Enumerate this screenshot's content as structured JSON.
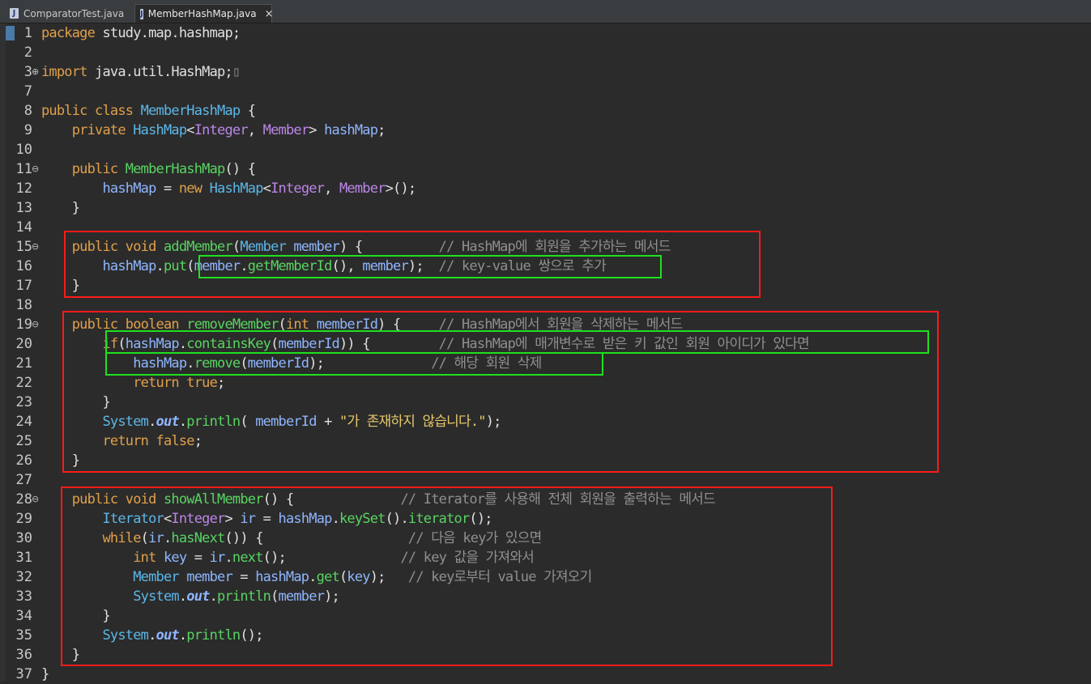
{
  "tabs": [
    {
      "label": "ComparatorTest.java",
      "active": false
    },
    {
      "label": "MemberHashMap.java",
      "active": true,
      "close": "×"
    }
  ],
  "editor": {
    "lines": [
      {
        "n": "1",
        "fold": "",
        "segs": [
          [
            "kw",
            "package"
          ],
          [
            "op",
            " study.map.hashmap;"
          ]
        ]
      },
      {
        "n": "2",
        "fold": "",
        "segs": []
      },
      {
        "n": "3",
        "fold": "+",
        "segs": [
          [
            "kw",
            "import"
          ],
          [
            "op",
            " java.util.HashMap;"
          ],
          [
            "cmt",
            "▯"
          ]
        ]
      },
      {
        "n": "7",
        "fold": "",
        "segs": []
      },
      {
        "n": "8",
        "fold": "",
        "segs": [
          [
            "kw",
            "public class "
          ],
          [
            "cls",
            "MemberHashMap"
          ],
          [
            "op",
            " {"
          ]
        ]
      },
      {
        "n": "9",
        "fold": "",
        "segs": [
          [
            "op",
            "    "
          ],
          [
            "kw",
            "private "
          ],
          [
            "cls",
            "HashMap"
          ],
          [
            "op",
            "<"
          ],
          [
            "typ",
            "Integer"
          ],
          [
            "op",
            ", "
          ],
          [
            "typ",
            "Member"
          ],
          [
            "op",
            "> "
          ],
          [
            "fld",
            "hashMap"
          ],
          [
            "op",
            ";"
          ]
        ]
      },
      {
        "n": "10",
        "fold": "",
        "segs": []
      },
      {
        "n": "11",
        "fold": "-",
        "segs": [
          [
            "op",
            "    "
          ],
          [
            "kw",
            "public "
          ],
          [
            "fn",
            "MemberHashMap"
          ],
          [
            "op",
            "() {"
          ]
        ]
      },
      {
        "n": "12",
        "fold": "",
        "segs": [
          [
            "op",
            "        "
          ],
          [
            "fld",
            "hashMap"
          ],
          [
            "op",
            " = "
          ],
          [
            "kw",
            "new "
          ],
          [
            "cls",
            "HashMap"
          ],
          [
            "op",
            "<"
          ],
          [
            "typ",
            "Integer"
          ],
          [
            "op",
            ", "
          ],
          [
            "typ",
            "Member"
          ],
          [
            "op",
            ">();"
          ]
        ]
      },
      {
        "n": "13",
        "fold": "",
        "segs": [
          [
            "op",
            "    }"
          ]
        ]
      },
      {
        "n": "14",
        "fold": "",
        "segs": []
      },
      {
        "n": "15",
        "fold": "-",
        "segs": [
          [
            "op",
            "    "
          ],
          [
            "kw",
            "public void "
          ],
          [
            "fn",
            "addMember"
          ],
          [
            "op",
            "("
          ],
          [
            "cls",
            "Member"
          ],
          [
            "op",
            " "
          ],
          [
            "fld",
            "member"
          ],
          [
            "op",
            ") {          "
          ],
          [
            "cmt",
            "// HashMap에 회원을 추가하는 메서드"
          ]
        ]
      },
      {
        "n": "16",
        "fold": "",
        "segs": [
          [
            "op",
            "        "
          ],
          [
            "fld",
            "hashMap"
          ],
          [
            "op",
            "."
          ],
          [
            "fn",
            "put"
          ],
          [
            "op",
            "("
          ],
          [
            "fld",
            "member"
          ],
          [
            "op",
            "."
          ],
          [
            "fn",
            "getMemberId"
          ],
          [
            "op",
            "(), "
          ],
          [
            "fld",
            "member"
          ],
          [
            "op",
            ");  "
          ],
          [
            "cmt",
            "// key-value 쌍으로 추가"
          ]
        ]
      },
      {
        "n": "17",
        "fold": "",
        "segs": [
          [
            "op",
            "    }"
          ]
        ]
      },
      {
        "n": "18",
        "fold": "",
        "segs": []
      },
      {
        "n": "19",
        "fold": "-",
        "segs": [
          [
            "op",
            "    "
          ],
          [
            "kw",
            "public boolean "
          ],
          [
            "fn",
            "removeMember"
          ],
          [
            "op",
            "("
          ],
          [
            "kw",
            "int "
          ],
          [
            "fld",
            "memberId"
          ],
          [
            "op",
            ") {     "
          ],
          [
            "cmt",
            "// HashMap에서 회원을 삭제하는 메서드"
          ]
        ]
      },
      {
        "n": "20",
        "fold": "",
        "segs": [
          [
            "op",
            "        "
          ],
          [
            "kw",
            "if"
          ],
          [
            "op",
            "("
          ],
          [
            "fld",
            "hashMap"
          ],
          [
            "op",
            "."
          ],
          [
            "fn",
            "containsKey"
          ],
          [
            "op",
            "("
          ],
          [
            "fld",
            "memberId"
          ],
          [
            "op",
            ")) {         "
          ],
          [
            "cmt",
            "// HashMap에 매개변수로 받은 키 값인 회원 아이디가 있다면"
          ]
        ]
      },
      {
        "n": "21",
        "fold": "",
        "segs": [
          [
            "op",
            "            "
          ],
          [
            "fld",
            "hashMap"
          ],
          [
            "op",
            "."
          ],
          [
            "fn",
            "remove"
          ],
          [
            "op",
            "("
          ],
          [
            "fld",
            "memberId"
          ],
          [
            "op",
            ");              "
          ],
          [
            "cmt",
            "// 해당 회원 삭제"
          ]
        ]
      },
      {
        "n": "22",
        "fold": "",
        "segs": [
          [
            "op",
            "            "
          ],
          [
            "kw",
            "return true"
          ],
          [
            "op",
            ";"
          ]
        ]
      },
      {
        "n": "23",
        "fold": "",
        "segs": [
          [
            "op",
            "        }"
          ]
        ]
      },
      {
        "n": "24",
        "fold": "",
        "segs": [
          [
            "op",
            "        "
          ],
          [
            "cls",
            "System"
          ],
          [
            "op",
            "."
          ],
          [
            "fld ital",
            "out"
          ],
          [
            "op",
            "."
          ],
          [
            "fn",
            "println"
          ],
          [
            "op",
            "( "
          ],
          [
            "fld",
            "memberId"
          ],
          [
            "op",
            " + "
          ],
          [
            "str",
            "\"가 존재하지 않습니다.\""
          ],
          [
            "op",
            ");"
          ]
        ]
      },
      {
        "n": "25",
        "fold": "",
        "segs": [
          [
            "op",
            "        "
          ],
          [
            "kw",
            "return false"
          ],
          [
            "op",
            ";"
          ]
        ]
      },
      {
        "n": "26",
        "fold": "",
        "segs": [
          [
            "op",
            "    }"
          ]
        ]
      },
      {
        "n": "27",
        "fold": "",
        "segs": []
      },
      {
        "n": "28",
        "fold": "-",
        "segs": [
          [
            "op",
            "    "
          ],
          [
            "kw",
            "public void "
          ],
          [
            "fn",
            "showAllMember"
          ],
          [
            "op",
            "() {              "
          ],
          [
            "cmt",
            "// Iterator를 사용해 전체 회원을 출력하는 메서드"
          ]
        ]
      },
      {
        "n": "29",
        "fold": "",
        "segs": [
          [
            "op",
            "        "
          ],
          [
            "cls",
            "Iterator"
          ],
          [
            "op",
            "<"
          ],
          [
            "typ",
            "Integer"
          ],
          [
            "op",
            "> "
          ],
          [
            "fld",
            "ir"
          ],
          [
            "op",
            " = "
          ],
          [
            "fld",
            "hashMap"
          ],
          [
            "op",
            "."
          ],
          [
            "fn",
            "keySet"
          ],
          [
            "op",
            "()."
          ],
          [
            "fn",
            "iterator"
          ],
          [
            "op",
            "();"
          ]
        ]
      },
      {
        "n": "30",
        "fold": "",
        "segs": [
          [
            "op",
            "        "
          ],
          [
            "kw",
            "while"
          ],
          [
            "op",
            "("
          ],
          [
            "fld",
            "ir"
          ],
          [
            "op",
            "."
          ],
          [
            "fn",
            "hasNext"
          ],
          [
            "op",
            "()) {                   "
          ],
          [
            "cmt",
            "// 다음 key가 있으면"
          ]
        ]
      },
      {
        "n": "31",
        "fold": "",
        "segs": [
          [
            "op",
            "            "
          ],
          [
            "kw",
            "int "
          ],
          [
            "fld",
            "key"
          ],
          [
            "op",
            " = "
          ],
          [
            "fld",
            "ir"
          ],
          [
            "op",
            "."
          ],
          [
            "fn",
            "next"
          ],
          [
            "op",
            "();               "
          ],
          [
            "cmt",
            "// key 값을 가져와서"
          ]
        ]
      },
      {
        "n": "32",
        "fold": "",
        "segs": [
          [
            "op",
            "            "
          ],
          [
            "cls",
            "Member "
          ],
          [
            "fld",
            "member"
          ],
          [
            "op",
            " = "
          ],
          [
            "fld",
            "hashMap"
          ],
          [
            "op",
            "."
          ],
          [
            "fn",
            "get"
          ],
          [
            "op",
            "("
          ],
          [
            "fld",
            "key"
          ],
          [
            "op",
            ");   "
          ],
          [
            "cmt",
            "// key로부터 value 가져오기"
          ]
        ]
      },
      {
        "n": "33",
        "fold": "",
        "segs": [
          [
            "op",
            "            "
          ],
          [
            "cls",
            "System"
          ],
          [
            "op",
            "."
          ],
          [
            "fld ital",
            "out"
          ],
          [
            "op",
            "."
          ],
          [
            "fn",
            "println"
          ],
          [
            "op",
            "("
          ],
          [
            "fld",
            "member"
          ],
          [
            "op",
            ");"
          ]
        ]
      },
      {
        "n": "34",
        "fold": "",
        "segs": [
          [
            "op",
            "        }"
          ]
        ]
      },
      {
        "n": "35",
        "fold": "",
        "segs": [
          [
            "op",
            "        "
          ],
          [
            "cls",
            "System"
          ],
          [
            "op",
            "."
          ],
          [
            "fld ital",
            "out"
          ],
          [
            "op",
            "."
          ],
          [
            "fn",
            "println"
          ],
          [
            "op",
            "();"
          ]
        ]
      },
      {
        "n": "36",
        "fold": "",
        "segs": [
          [
            "op",
            "    }"
          ]
        ]
      },
      {
        "n": "37",
        "fold": "",
        "segs": [
          [
            "op",
            "}"
          ]
        ]
      }
    ]
  },
  "colors": {
    "red_box": "#ff1a1a",
    "green_box": "#1fe01f",
    "background": "#2b2b2b"
  },
  "icons": {
    "java_file": "java-file-icon",
    "close": "close-icon"
  }
}
